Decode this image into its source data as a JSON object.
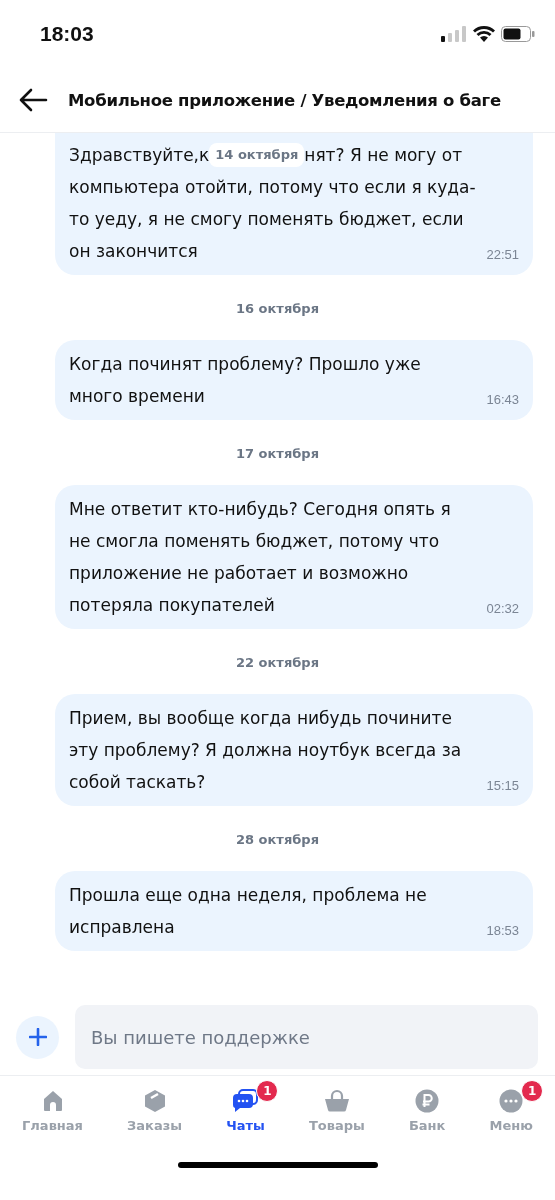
{
  "status_bar": {
    "time": "18:03"
  },
  "header": {
    "title": "Мобильное приложение / Уведомления о баге"
  },
  "messages": [
    {
      "text_start": "Здравствуйте,к",
      "sticky_date": "14 октября",
      "text_after": "нят? Я не могу от",
      "text": "компьютера отойти, потому что если я куда-то уеду, я не смогу поменять бюджет, если он закончится",
      "time": "22:51"
    },
    {
      "date": "16 октября",
      "text": "Когда починят проблему? Прошло уже много времени",
      "time": "16:43"
    },
    {
      "date": "17 октября",
      "text": "Мне ответит кто-нибудь? Сегодня опять я не смогла поменять бюджет, потому что приложение не работает и возможно потеряла покупателей",
      "time": "02:32"
    },
    {
      "date": "22 октября",
      "text": "Прием, вы вообще когда нибудь почините эту проблему? Я должна ноутбук всегда за собой таскать?",
      "time": "15:15"
    },
    {
      "date": "28 октября",
      "text": "Прошла еще одна неделя, проблема не исправлена",
      "time": "18:53"
    }
  ],
  "composer": {
    "placeholder": "Вы пишете поддержке"
  },
  "tabs": [
    {
      "label": "Главная",
      "selected": false
    },
    {
      "label": "Заказы",
      "selected": false
    },
    {
      "label": "Чаты",
      "selected": true,
      "badge": "1"
    },
    {
      "label": "Товары",
      "selected": false
    },
    {
      "label": "Банк",
      "selected": false
    },
    {
      "label": "Меню",
      "selected": false,
      "badge": "1"
    }
  ]
}
